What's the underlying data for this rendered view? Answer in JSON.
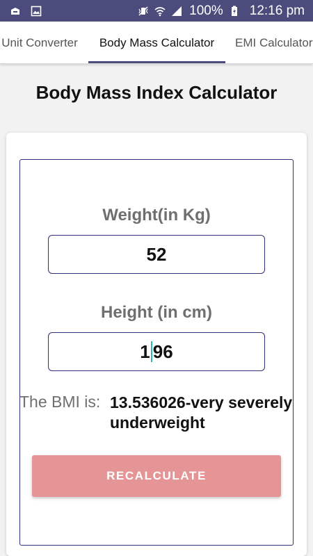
{
  "status_bar": {
    "battery": "100%",
    "time": "12:16 pm"
  },
  "tabs": [
    {
      "label": "Unit Converter",
      "active": false
    },
    {
      "label": "Body Mass Calculator",
      "active": true
    },
    {
      "label": "EMI Calculator",
      "active": false
    }
  ],
  "page_title": "Body Mass Index Calculator",
  "weight": {
    "label": "Weight(in Kg)",
    "value": "52"
  },
  "height": {
    "label": "Height (in cm)",
    "value_before_cursor": "1",
    "value_after_cursor": "96"
  },
  "result": {
    "label": "The BMI is:",
    "value": "13.536026-very severely underweight"
  },
  "recalculate_label": "RECALCULATE",
  "colors": {
    "status_bar": "#4b4b7c",
    "accent": "#4b4b7c",
    "button": "#e69597",
    "cursor": "#2bbcb0"
  }
}
